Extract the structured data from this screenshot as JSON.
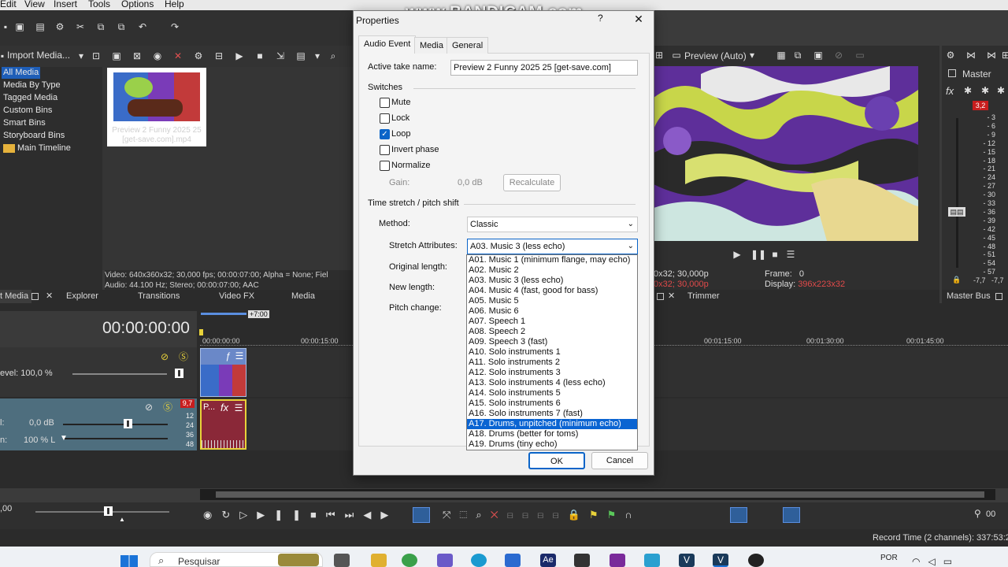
{
  "menu": {
    "items": [
      "Edit",
      "View",
      "Insert",
      "Tools",
      "Options",
      "Help"
    ]
  },
  "watermark": "www.BANDICAM.com",
  "media_toolbar": {
    "import_label": "Import Media..."
  },
  "media_tree": {
    "items": [
      "All Media",
      "Media By Type",
      "Tagged Media",
      "Custom Bins",
      "Smart Bins",
      "Storyboard Bins",
      "Main Timeline"
    ]
  },
  "media_thumb": {
    "caption": "Preview 2 Funny 2025 25 [get-save.com].mp4"
  },
  "media_info": {
    "video": "Video: 640x360x32; 30,000 fps; 00:00:07:00; Alpha = None; Fiel",
    "audio": "Audio: 44.100 Hz; Stereo; 00:00:07:00; AAC"
  },
  "bottom_tabs": {
    "project_media": "t Media",
    "explorer": "Explorer",
    "transitions": "Transitions",
    "video_fx": "Video FX",
    "media_generators": "Media Generator",
    "trimmer": "Trimmer",
    "master_bus": "Master Bus"
  },
  "preview": {
    "mode": "Preview (Auto)",
    "project": "0x32; 30,000p",
    "preview": "0x32; 30,000p",
    "frame_label": "Frame:",
    "frame_value": "0",
    "display_label": "Display:",
    "display_value": "396x223x32"
  },
  "master": {
    "label": "Master",
    "peak": "3,2",
    "scale": [
      "3",
      "6",
      "9",
      "12",
      "15",
      "18",
      "21",
      "24",
      "27",
      "30",
      "33",
      "36",
      "39",
      "42",
      "45",
      "48",
      "51",
      "54",
      "57"
    ],
    "bottom_left": "-7,7",
    "bottom_right": "-7,7"
  },
  "timeline": {
    "timecode": "00:00:00:00",
    "region_end": "+7:00",
    "ruler": [
      "00:00:00:00",
      "00:00:15:00",
      "00:01:15:00",
      "00:01:30:00",
      "00:01:45:00"
    ],
    "video_level": "evel: 100,0 %",
    "audio_vol_label": "l:",
    "audio_vol": "0,0 dB",
    "audio_pan_label": "n:",
    "audio_pan": "100 % L",
    "audio_peak": "9,7",
    "audio_scale": [
      "12",
      "24",
      "36",
      "48"
    ],
    "audio_clip_label": "P...",
    "rate": ",00",
    "record_time": "Record Time (2 channels): 337:53:2"
  },
  "dialog": {
    "title": "Properties",
    "tabs": [
      "Audio Event",
      "Media",
      "General"
    ],
    "active_take_label": "Active take name:",
    "active_take_value": "Preview 2 Funny 2025 25 [get-save.com]",
    "switches_label": "Switches",
    "switches": [
      {
        "label": "Mute",
        "checked": false
      },
      {
        "label": "Lock",
        "checked": false
      },
      {
        "label": "Loop",
        "checked": true
      },
      {
        "label": "Invert phase",
        "checked": false
      },
      {
        "label": "Normalize",
        "checked": false
      }
    ],
    "gain_label": "Gain:",
    "gain_value": "0,0 dB",
    "recalculate": "Recalculate",
    "timestretch_label": "Time stretch / pitch shift",
    "method_label": "Method:",
    "method_value": "Classic",
    "stretch_label": "Stretch Attributes:",
    "stretch_value": "A03. Music 3 (less echo)",
    "original_length_label": "Original length:",
    "new_length_label": "New length:",
    "pitch_change_label": "Pitch change:",
    "options": [
      "A01. Music 1 (minimum flange, may echo)",
      "A02. Music 2",
      "A03. Music 3 (less echo)",
      "A04. Music 4 (fast, good for bass)",
      "A05. Music 5",
      "A06. Music 6",
      "A07. Speech 1",
      "A08. Speech 2",
      "A09. Speech 3 (fast)",
      "A10. Solo instruments 1",
      "A11. Solo instruments 2",
      "A12. Solo instruments 3",
      "A13. Solo instruments 4 (less echo)",
      "A14. Solo instruments 5",
      "A15. Solo instruments 6",
      "A16. Solo instruments 7 (fast)",
      "A17. Drums, unpitched (minimum echo)",
      "A18. Drums (better for toms)",
      "A19. Drums (tiny echo)"
    ],
    "highlighted_option": "A17. Drums, unpitched (minimum echo)",
    "ok": "OK",
    "cancel": "Cancel"
  },
  "taskbar": {
    "search_placeholder": "Pesquisar",
    "lang": "POR"
  }
}
